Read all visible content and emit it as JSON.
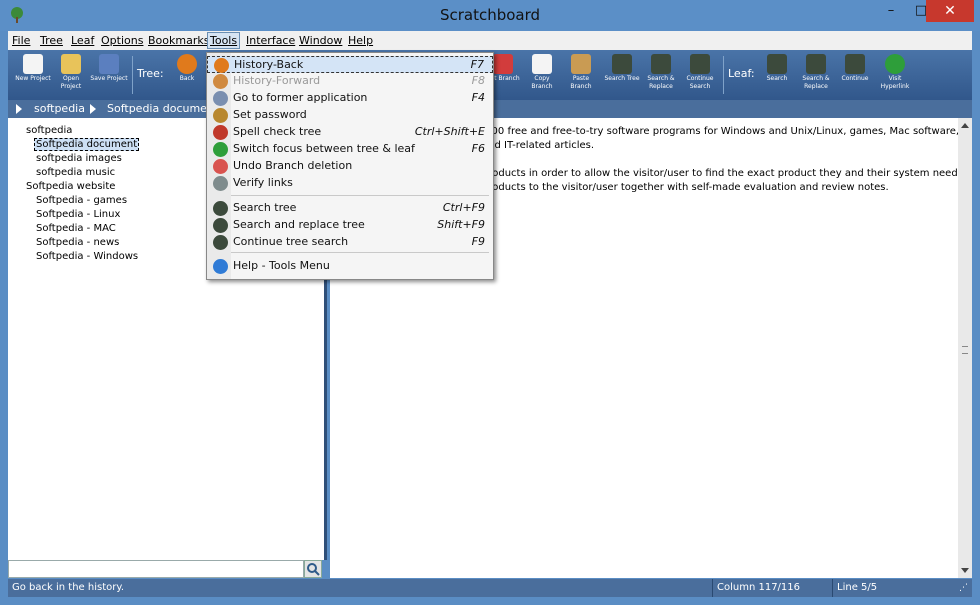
{
  "window": {
    "title": "Scratchboard",
    "minimize": "–",
    "maximize": "□",
    "close": "✕"
  },
  "menubar": [
    "File",
    "Tree",
    "Leaf",
    "Options",
    "Bookmarks",
    "Tools",
    "Interface",
    "Window",
    "Help"
  ],
  "toolbar": {
    "project_buttons": [
      {
        "label": "New Project",
        "icon": "new-project-icon"
      },
      {
        "label": "Open Project",
        "icon": "open-project-icon"
      },
      {
        "label": "Save Project",
        "icon": "save-project-icon"
      }
    ],
    "tree_label": "Tree:",
    "tree_buttons": [
      {
        "label": "Back",
        "icon": "back-icon"
      },
      {
        "label": "Cut Branch",
        "icon": "cut-branch-icon"
      },
      {
        "label": "Copy Branch",
        "icon": "copy-branch-icon"
      },
      {
        "label": "Paste Branch",
        "icon": "paste-branch-icon"
      },
      {
        "label": "Search Tree",
        "icon": "search-tree-icon"
      },
      {
        "label": "Search & Replace",
        "icon": "search-replace-icon"
      },
      {
        "label": "Continue Search",
        "icon": "continue-search-icon"
      }
    ],
    "leaf_label": "Leaf:",
    "leaf_buttons": [
      {
        "label": "Search",
        "icon": "leaf-search-icon"
      },
      {
        "label": "Search & Replace",
        "icon": "leaf-search-replace-icon"
      },
      {
        "label": "Continue",
        "icon": "leaf-continue-icon"
      },
      {
        "label": "Visit Hyperlink",
        "icon": "visit-hyperlink-icon"
      }
    ]
  },
  "breadcrumb": [
    "softpedia",
    "Softpedia document"
  ],
  "tree": [
    {
      "label": "softpedia",
      "level": 0
    },
    {
      "label": "Softpedia document",
      "level": 1,
      "selected": true
    },
    {
      "label": "softpedia images",
      "level": 1
    },
    {
      "label": "softpedia music",
      "level": 1
    },
    {
      "label": "Softpedia website",
      "level": 0
    },
    {
      "label": "Softpedia - games",
      "level": 1
    },
    {
      "label": "Softpedia - Linux",
      "level": 1
    },
    {
      "label": "Softpedia - MAC",
      "level": 1
    },
    {
      "label": "Softpedia - news",
      "level": 1
    },
    {
      "label": "Softpedia - Windows",
      "level": 1
    }
  ],
  "content_lines": [
    ",000 free and free-to-try software programs for Windows and Unix/Linux, games, Mac software,",
    "and IT-related articles.",
    "",
    "products in order to allow the visitor/user to find the exact product they and their system needs.",
    "products to the visitor/user together with self-made evaluation and review notes."
  ],
  "tools_menu": [
    {
      "label": "History-Back",
      "shortcut": "F7",
      "icon": "history-back-icon",
      "highlighted": true,
      "disabled": false,
      "color": "#e07a1c"
    },
    {
      "label": "History-Forward",
      "shortcut": "F8",
      "icon": "history-forward-icon",
      "highlighted": false,
      "disabled": true,
      "color": "#d08a40"
    },
    {
      "label": "Go to former application",
      "shortcut": "F4",
      "icon": "former-application-icon",
      "highlighted": false,
      "disabled": false,
      "color": "#7a8fb0"
    },
    {
      "label": "Set password",
      "shortcut": "",
      "icon": "lock-icon",
      "highlighted": false,
      "disabled": false,
      "color": "#b8872e"
    },
    {
      "label": "Spell check tree",
      "shortcut": "Ctrl+Shift+E",
      "icon": "spell-check-icon",
      "highlighted": false,
      "disabled": false,
      "color": "#c0392b"
    },
    {
      "label": "Switch focus between tree & leaf",
      "shortcut": "F6",
      "icon": "switch-focus-icon",
      "highlighted": false,
      "disabled": false,
      "color": "#2e9e3a"
    },
    {
      "label": "Undo Branch deletion",
      "shortcut": "",
      "icon": "eraser-icon",
      "highlighted": false,
      "disabled": false,
      "color": "#d9534f"
    },
    {
      "label": "Verify links",
      "shortcut": "",
      "icon": "chain-link-icon",
      "highlighted": false,
      "disabled": false,
      "color": "#7f8c8d"
    },
    {
      "label": "Search tree",
      "shortcut": "Ctrl+F9",
      "icon": "binoculars-icon",
      "highlighted": false,
      "disabled": false,
      "color": "#3c4a3c"
    },
    {
      "label": "Search and replace tree",
      "shortcut": "Shift+F9",
      "icon": "binoculars-replace-icon",
      "highlighted": false,
      "disabled": false,
      "color": "#3c4a3c"
    },
    {
      "label": "Continue tree search",
      "shortcut": "F9",
      "icon": "binoculars-continue-icon",
      "highlighted": false,
      "disabled": false,
      "color": "#3c4a3c"
    },
    {
      "label": "Help - Tools Menu",
      "shortcut": "",
      "icon": "help-icon",
      "highlighted": false,
      "disabled": false,
      "color": "#2f7bd6"
    }
  ],
  "status": {
    "message": "Go back in the history.",
    "column": "Column 117/116",
    "line": "Line 5/5"
  },
  "colors": {
    "accent": "#5b8fc7",
    "toolbar": "#3d6598",
    "close": "#c7382d"
  }
}
